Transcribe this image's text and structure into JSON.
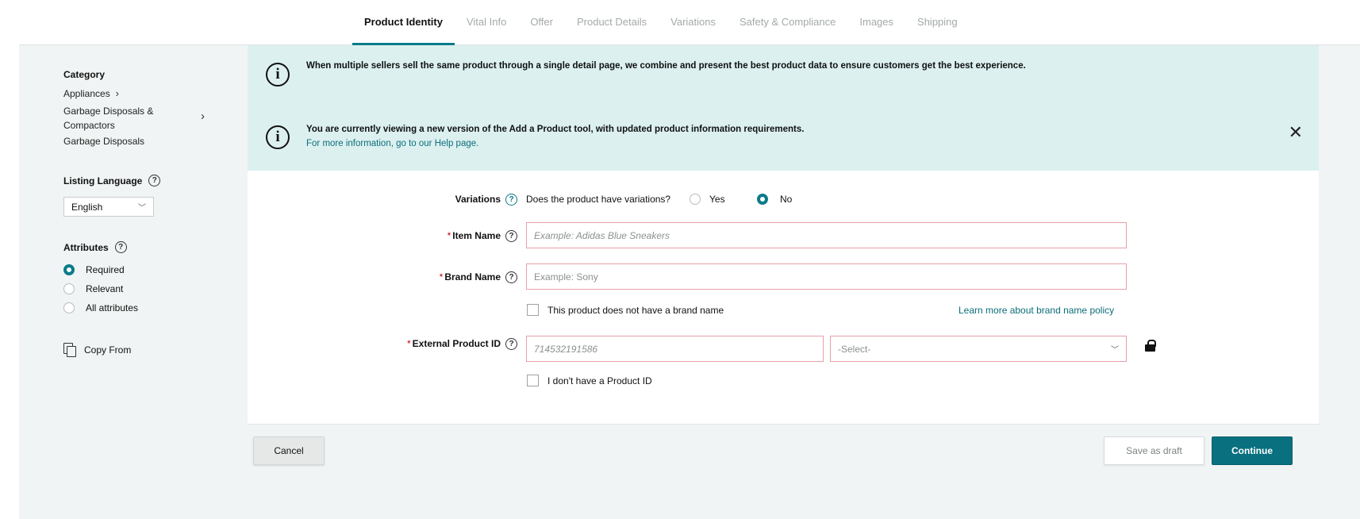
{
  "tabs": [
    {
      "label": "Product Identity",
      "active": true
    },
    {
      "label": "Vital Info",
      "active": false
    },
    {
      "label": "Offer",
      "active": false
    },
    {
      "label": "Product Details",
      "active": false
    },
    {
      "label": "Variations",
      "active": false
    },
    {
      "label": "Safety & Compliance",
      "active": false
    },
    {
      "label": "Images",
      "active": false
    },
    {
      "label": "Shipping",
      "active": false
    }
  ],
  "sidebar": {
    "category_title": "Category",
    "category_path": [
      "Appliances",
      "Garbage Disposals &",
      "Compactors",
      "Garbage Disposals"
    ],
    "listing_language_title": "Listing Language",
    "listing_language_value": "English",
    "attributes_title": "Attributes",
    "attribute_options": [
      {
        "label": "Required",
        "selected": true
      },
      {
        "label": "Relevant",
        "selected": false
      },
      {
        "label": "All attributes",
        "selected": false
      }
    ],
    "copy_from_label": "Copy From"
  },
  "banners": {
    "banner1_text": "When multiple sellers sell the same product through a single detail page, we combine and present the best product data to ensure customers get the best experience.",
    "banner2_text": "You are currently viewing a new version of the Add a Product tool, with updated product information requirements.",
    "banner2_link": "For more information, go to our Help page."
  },
  "form": {
    "variations_label": "Variations",
    "variations_question": "Does the product have variations?",
    "variations_yes": "Yes",
    "variations_no": "No",
    "variations_selected": "No",
    "item_name_label": "Item Name",
    "item_name_placeholder": "Example: Adidas Blue Sneakers",
    "brand_name_label": "Brand Name",
    "brand_name_placeholder": "Example: Sony",
    "no_brand_label": "This product does not have a brand name",
    "brand_policy_link": "Learn more about brand name policy",
    "external_id_label": "External Product ID",
    "external_id_placeholder": "714532191586",
    "external_id_type": "-Select-",
    "no_product_id_label": "I don't have a Product ID"
  },
  "footer": {
    "cancel_label": "Cancel",
    "save_draft_label": "Save as draft",
    "continue_label": "Continue"
  },
  "colors": {
    "accent": "#0a7b8a",
    "banner_bg": "#dcf0f0",
    "required_border": "#e8a0a8"
  },
  "icons": [
    "info-icon",
    "help-icon",
    "close-icon",
    "chevron-right-icon",
    "chevron-down-icon",
    "copy-icon",
    "lock-icon"
  ]
}
